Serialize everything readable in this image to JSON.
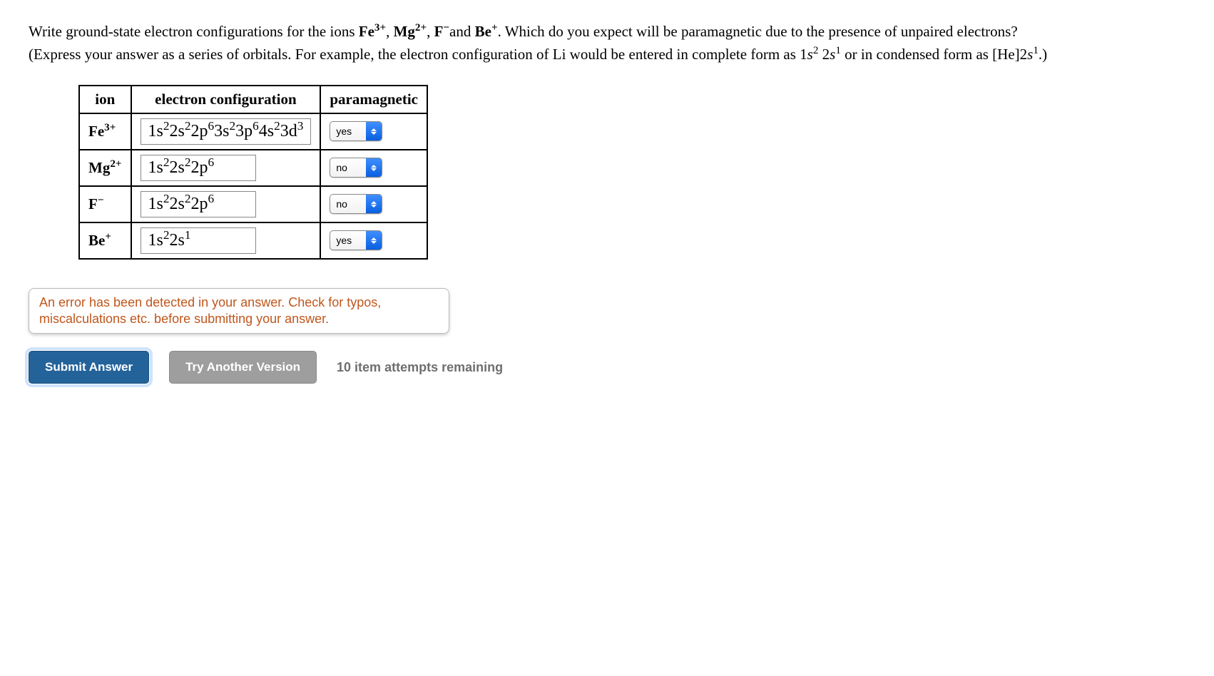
{
  "question": {
    "line1_pre": "Write ground-state electron configurations for the ions ",
    "ion1": "Fe",
    "ion1_sup": "3+",
    "sep1": ", ",
    "ion2": "Mg",
    "ion2_sup": "2+",
    "sep2": ", ",
    "ion3": "F",
    "ion3_sup": "−",
    "and": "and ",
    "ion4": "Be",
    "ion4_sup": "+",
    "line1_post": ". Which do you expect will be paramagnetic due to the presence of unpaired electrons?",
    "line2_pre": "(Express your answer as a series of orbitals. For example, the electron configuration of Li would be entered in complete form as 1",
    "li_s": "s",
    "li_s_sup": "2",
    "li_sp": " 2",
    "li_s2": "s",
    "li_s2_sup": "1",
    "line2_mid": " or in condensed form as [He]2",
    "li_c": "s",
    "li_c_sup": "1",
    "line2_post": ".)"
  },
  "table": {
    "headers": {
      "ion": "ion",
      "config": "electron configuration",
      "para": "paramagnetic"
    },
    "rows": [
      {
        "ion_base": "Fe",
        "ion_sup": "3+",
        "config_parts": [
          {
            "t": "1s",
            "sup": "2"
          },
          {
            "t": "2s",
            "sup": "2"
          },
          {
            "t": "2p",
            "sup": "6"
          },
          {
            "t": "3s",
            "sup": "2"
          },
          {
            "t": "3p",
            "sup": "6"
          },
          {
            "t": "4s",
            "sup": "2"
          },
          {
            "t": "3d",
            "sup": "3"
          }
        ],
        "para": "yes"
      },
      {
        "ion_base": "Mg",
        "ion_sup": "2+",
        "config_parts": [
          {
            "t": "1s",
            "sup": "2"
          },
          {
            "t": "2s",
            "sup": "2"
          },
          {
            "t": "2p",
            "sup": "6"
          }
        ],
        "para": "no"
      },
      {
        "ion_base": "F",
        "ion_sup": "−",
        "config_parts": [
          {
            "t": "1s",
            "sup": "2"
          },
          {
            "t": "2s",
            "sup": "2"
          },
          {
            "t": "2p",
            "sup": "6"
          }
        ],
        "para": "no"
      },
      {
        "ion_base": "Be",
        "ion_sup": "+",
        "config_parts": [
          {
            "t": "1s",
            "sup": "2"
          },
          {
            "t": "2s",
            "sup": "1"
          }
        ],
        "para": "yes"
      }
    ]
  },
  "error": "An error has been detected in your answer. Check for typos, miscalculations etc. before submitting your answer.",
  "buttons": {
    "submit": "Submit Answer",
    "try_another": "Try Another Version"
  },
  "attempts": "10 item attempts remaining"
}
